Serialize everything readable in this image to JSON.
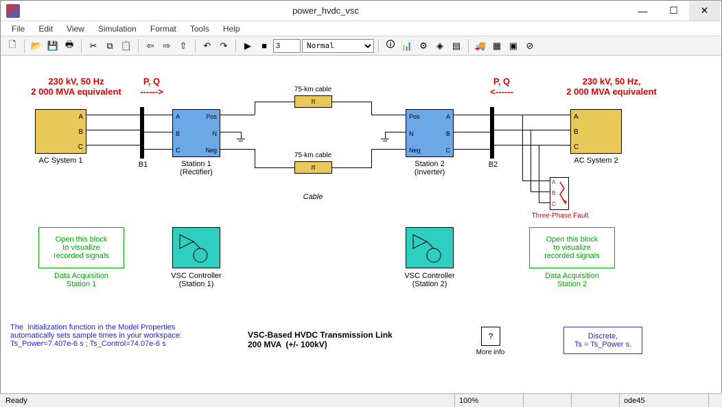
{
  "window": {
    "title": "power_hvdc_vsc"
  },
  "menu": {
    "file": "File",
    "edit": "Edit",
    "view": "View",
    "simulation": "Simulation",
    "format": "Format",
    "tools": "Tools",
    "help": "Help"
  },
  "toolbar": {
    "step_value": "3",
    "mode": "Normal"
  },
  "red_labels": {
    "sys1": "230 kV, 50 Hz\n2 000 MVA equivalent",
    "pq1": "P, Q\n------>",
    "pq2": "P, Q\n<------",
    "sys2": "230 kV, 50 Hz,\n2 000 MVA equivalent",
    "fault": "Three-Phase Fault"
  },
  "ports": {
    "A": "A",
    "B": "B",
    "C": "C",
    "Pos": "Pos",
    "N": "N",
    "Neg": "Neg"
  },
  "blocks": {
    "ac1": "AC System 1",
    "ac2": "AC System 2",
    "b1": "B1",
    "b2": "B2",
    "st1": "Station 1\n(Rectifier)",
    "st2": "Station 2\n(Inverter)",
    "cable_top": "75-km cable",
    "cable_bot": "75-km cable",
    "cable_mid": "Cable",
    "daq_text": "Open this block\nto visualize\nrecorded signals",
    "daq1": "Data Acquisition\nStation 1",
    "daq2": "Data Acquisition\nStation 2",
    "vsc1": "VSC Controller\n(Station 1)",
    "vsc2": "VSC Controller\n(Station 2)",
    "moreinfo": "More info",
    "pgui": "Discrete,\nTs = Ts_Power s."
  },
  "notes": {
    "init": "The  Initialization function in the Model Properties\nautomatically sets sample times in your workspace:\nTs_Power=7.407e-6 s ; Ts_Control=74.07e-6 s",
    "title": "VSC-Based HVDC Transmission Link\n200 MVA  (+/- 100kV)"
  },
  "status": {
    "ready": "Ready",
    "zoom": "100%",
    "solver": "ode45"
  }
}
